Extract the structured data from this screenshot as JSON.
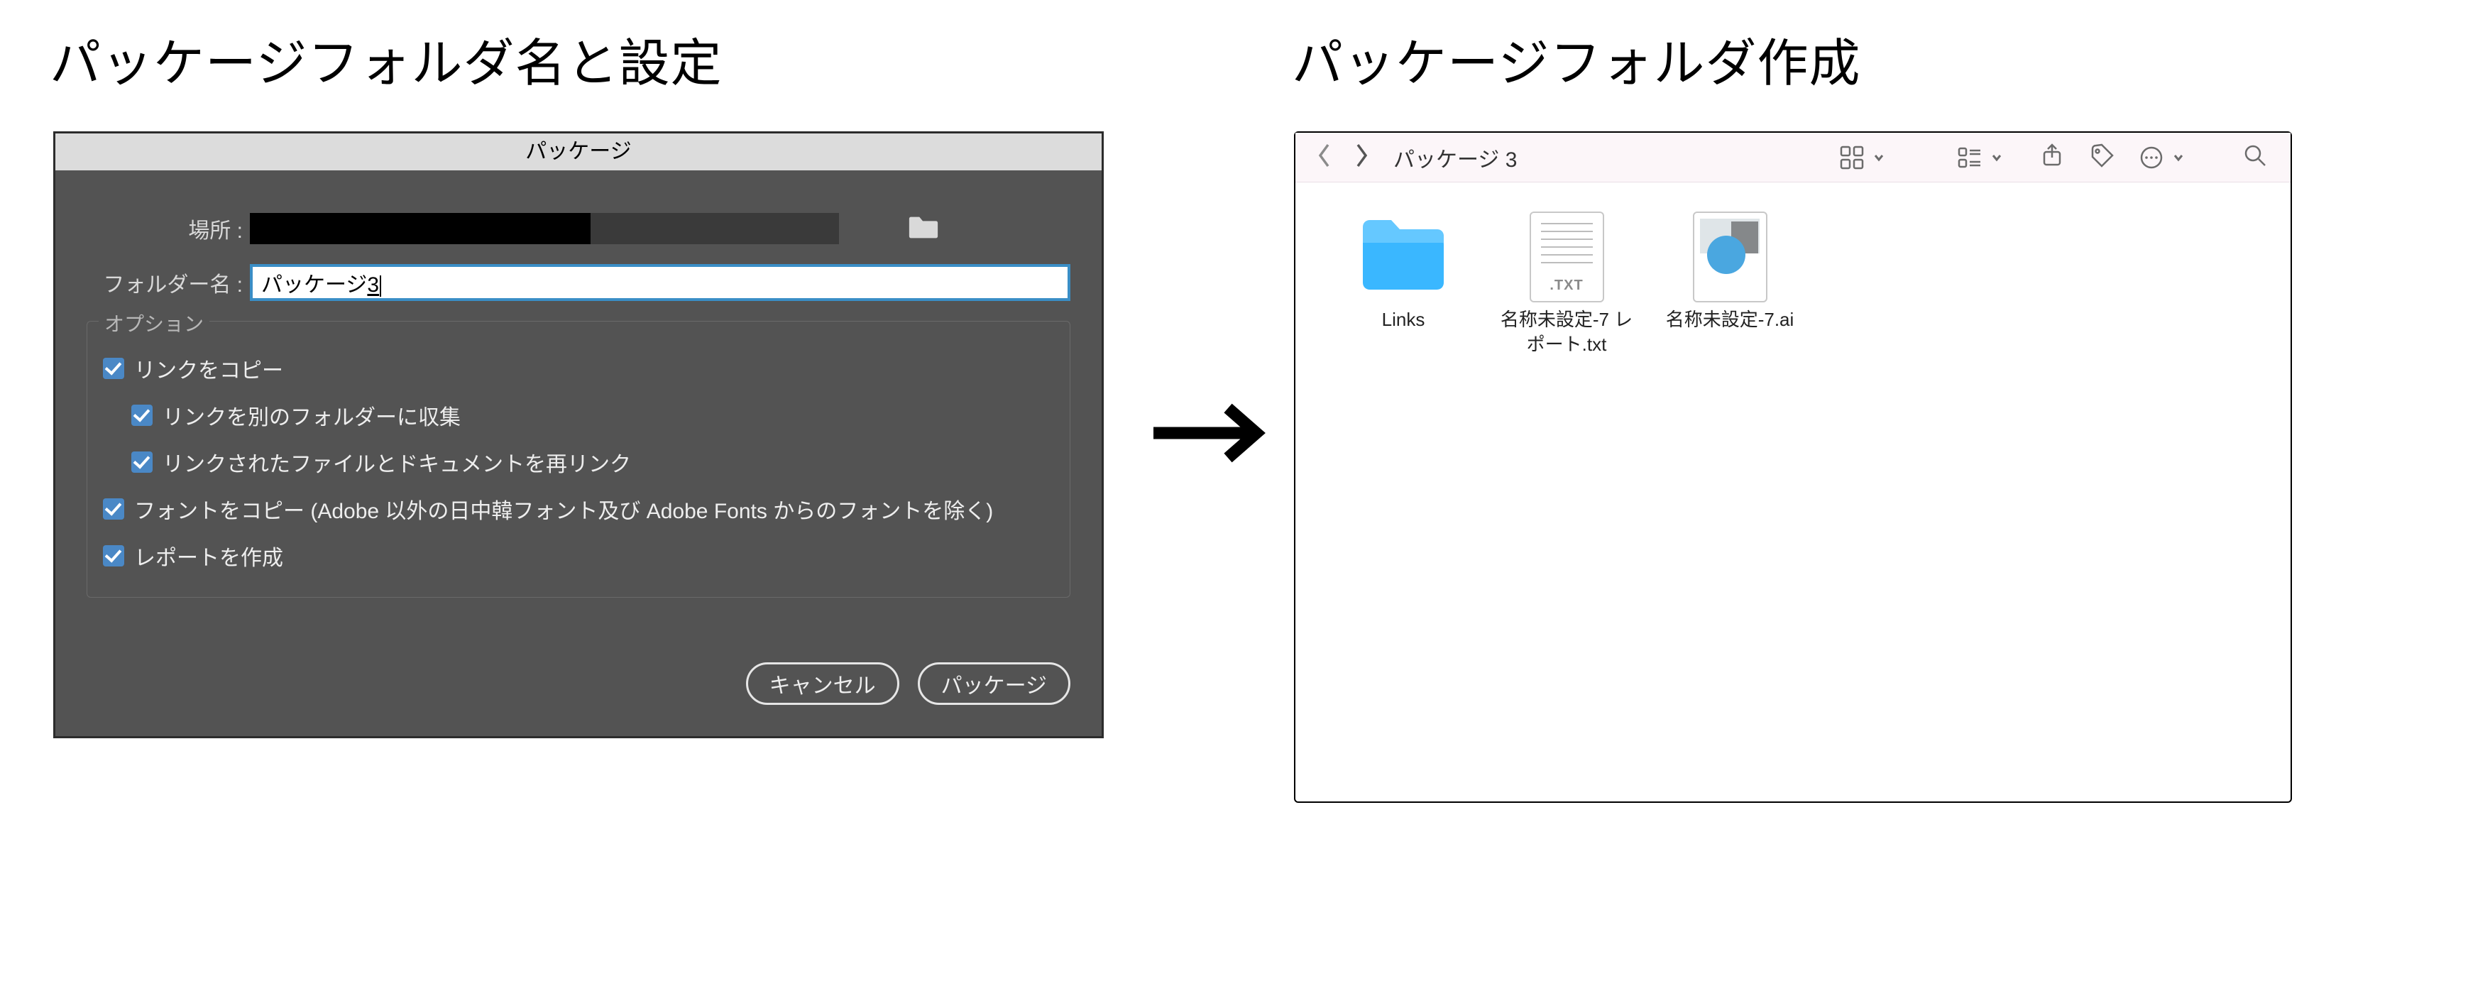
{
  "captions": {
    "left": "パッケージフォルダ名と設定",
    "right": "パッケージフォルダ作成"
  },
  "dialog": {
    "title": "パッケージ",
    "location_label": "場所 :",
    "foldername_label": "フォルダー名 :",
    "foldername_prefix": "パッケージ",
    "foldername_suffix": "3",
    "options_legend": "オプション",
    "options": {
      "copy_links": "リンクをコピー",
      "collect_links": "リンクを別のフォルダーに収集",
      "relink": "リンクされたファイルとドキュメントを再リンク",
      "copy_fonts": "フォントをコピー (Adobe 以外の日中韓フォント及び Adobe Fonts からのフォントを除く)",
      "create_report": "レポートを作成"
    },
    "buttons": {
      "cancel": "キャンセル",
      "package": "パッケージ"
    }
  },
  "finder": {
    "title": "パッケージ 3",
    "txt_ext": ".TXT",
    "items": {
      "folder": "Links",
      "txt": "名称未設定-7 レポート.txt",
      "ai": "名称未設定-7.ai"
    }
  }
}
